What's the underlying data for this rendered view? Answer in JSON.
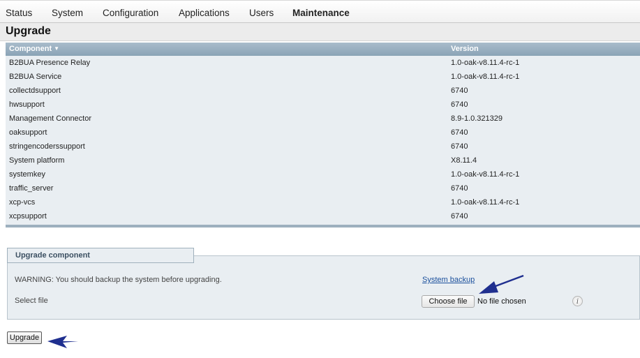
{
  "nav": {
    "items": [
      {
        "label": "Status"
      },
      {
        "label": "System"
      },
      {
        "label": "Configuration"
      },
      {
        "label": "Applications"
      },
      {
        "label": "Users"
      },
      {
        "label": "Maintenance",
        "active": true
      }
    ]
  },
  "page": {
    "title": "Upgrade"
  },
  "table": {
    "columns": [
      "Component",
      "Version"
    ],
    "sort_indicator": "▼",
    "rows": [
      {
        "component": "B2BUA Presence Relay",
        "version": "1.0-oak-v8.11.4-rc-1"
      },
      {
        "component": "B2BUA Service",
        "version": "1.0-oak-v8.11.4-rc-1"
      },
      {
        "component": "collectdsupport",
        "version": "6740"
      },
      {
        "component": "hwsupport",
        "version": "6740"
      },
      {
        "component": "Management Connector",
        "version": "8.9-1.0.321329"
      },
      {
        "component": "oaksupport",
        "version": "6740"
      },
      {
        "component": "stringencoderssupport",
        "version": "6740"
      },
      {
        "component": "System platform",
        "version": "X8.11.4"
      },
      {
        "component": "systemkey",
        "version": "1.0-oak-v8.11.4-rc-1"
      },
      {
        "component": "traffic_server",
        "version": "6740"
      },
      {
        "component": "xcp-vcs",
        "version": "1.0-oak-v8.11.4-rc-1"
      },
      {
        "component": "xcpsupport",
        "version": "6740"
      }
    ]
  },
  "upgrade_component": {
    "legend": "Upgrade component",
    "warning": "WARNING: You should backup the system before upgrading.",
    "backup_link": "System backup",
    "select_label": "Select file",
    "choose_button": "Choose file",
    "file_status": "No file chosen",
    "info_icon": "info-icon"
  },
  "actions": {
    "upgrade_label": "Upgrade"
  },
  "colors": {
    "arrow": "#1f2f8f",
    "header": "#8aa3b6",
    "link": "#1a4f9c"
  }
}
